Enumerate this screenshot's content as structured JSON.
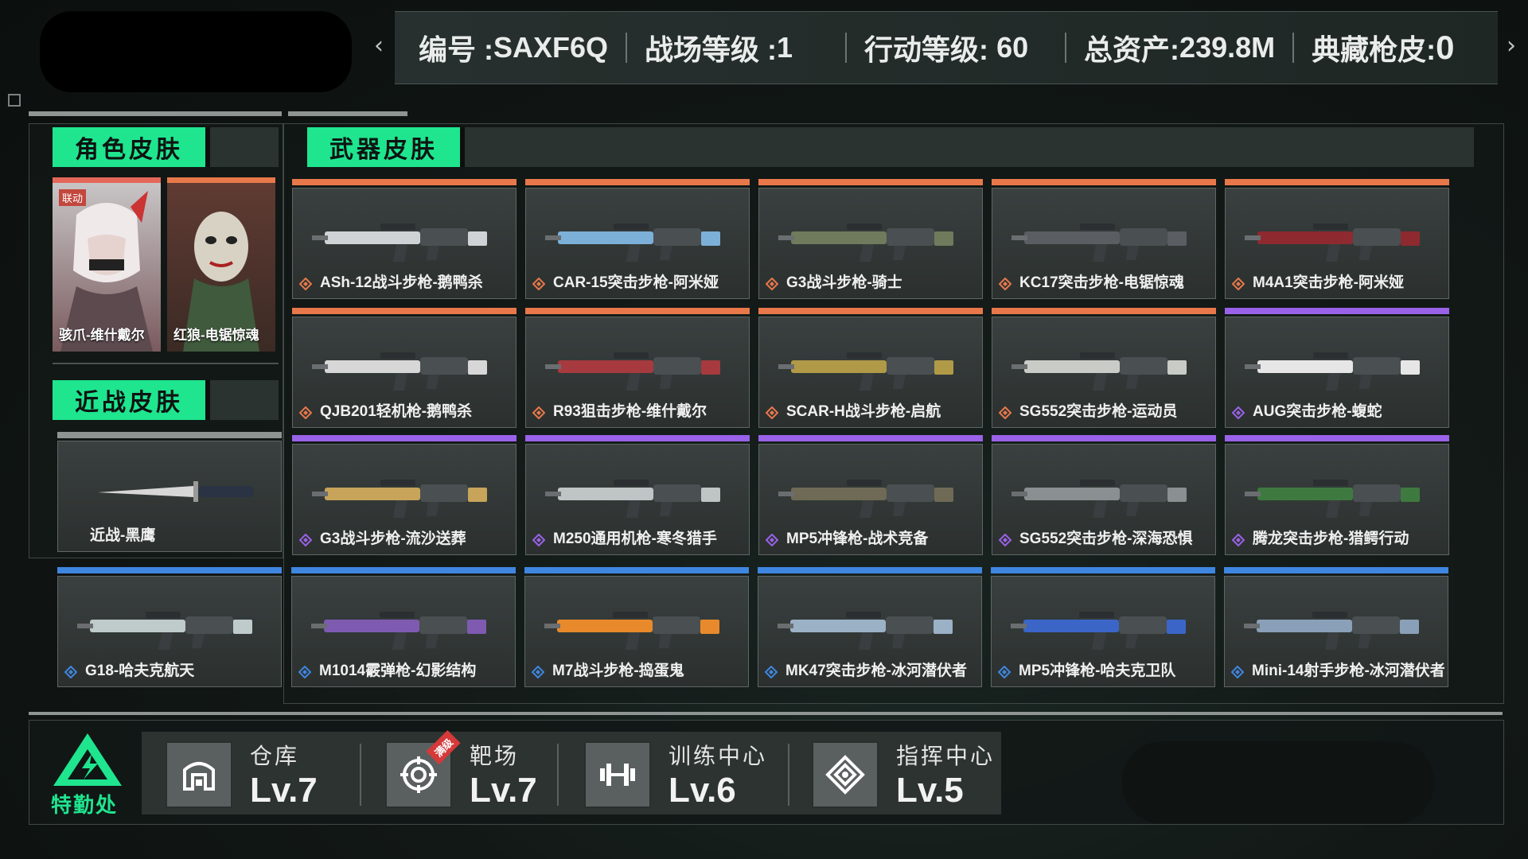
{
  "header": {
    "id_label": "编号 :",
    "id_value": "SAXF6Q",
    "battlefield_label": "战场等级 :",
    "battlefield_value": "1",
    "ops_label": "行动等级:",
    "ops_value": "60",
    "assets_label": "总资产:",
    "assets_value": "239.8M",
    "skins_label": "典藏枪皮:",
    "skins_value": "0"
  },
  "sections": {
    "character": "角色皮肤",
    "melee": "近战皮肤",
    "weapon": "武器皮肤"
  },
  "characters": [
    {
      "name": "骇爪-维什戴尔",
      "badge": "联动"
    },
    {
      "name": "红狼-电锯惊魂"
    }
  ],
  "melee": [
    {
      "name": "近战-黑鹰"
    }
  ],
  "colors": {
    "orange": "#e8784a",
    "purple": "#9a62e8",
    "blue": "#3f86e0",
    "accent": "#1fe58f"
  },
  "weapons": [
    {
      "name": "ASh-12战斗步枪-鹅鸭杀",
      "rarity": "orange"
    },
    {
      "name": "CAR-15突击步枪-阿米娅",
      "rarity": "orange"
    },
    {
      "name": "G3战斗步枪-骑士",
      "rarity": "orange"
    },
    {
      "name": "KC17突击步枪-电锯惊魂",
      "rarity": "orange"
    },
    {
      "name": "M4A1突击步枪-阿米娅",
      "rarity": "orange"
    },
    {
      "name": "QJB201轻机枪-鹅鸭杀",
      "rarity": "orange"
    },
    {
      "name": "R93狙击步枪-维什戴尔",
      "rarity": "orange"
    },
    {
      "name": "SCAR-H战斗步枪-启航",
      "rarity": "orange"
    },
    {
      "name": "SG552突击步枪-运动员",
      "rarity": "orange"
    },
    {
      "name": "AUG突击步枪-蝮蛇",
      "rarity": "purple"
    },
    {
      "name": "G3战斗步枪-流沙送葬",
      "rarity": "purple"
    },
    {
      "name": "M250通用机枪-寒冬猎手",
      "rarity": "purple"
    },
    {
      "name": "MP5冲锋枪-战术竞备",
      "rarity": "purple"
    },
    {
      "name": "SG552突击步枪-深海恐惧",
      "rarity": "purple"
    },
    {
      "name": "腾龙突击步枪-猎鳄行动",
      "rarity": "purple"
    },
    {
      "name": "G18-哈夫克航天",
      "rarity": "blue"
    },
    {
      "name": "M1014霰弹枪-幻影结构",
      "rarity": "blue"
    },
    {
      "name": "M7战斗步枪-捣蛋鬼",
      "rarity": "blue"
    },
    {
      "name": "MK47突击步枪-冰河潜伏者",
      "rarity": "blue"
    },
    {
      "name": "MP5冲锋枪-哈夫克卫队",
      "rarity": "blue"
    },
    {
      "name": "Mini-14射手步枪-冰河潜伏者",
      "rarity": "blue"
    }
  ],
  "footer": {
    "logo_text": "特勤处",
    "facilities": [
      {
        "name": "仓库",
        "level": "Lv.7",
        "icon": "warehouse-icon"
      },
      {
        "name": "靶场",
        "level": "Lv.7",
        "icon": "target-icon",
        "tag": "满级"
      },
      {
        "name": "训练中心",
        "level": "Lv.6",
        "icon": "dumbbell-icon"
      },
      {
        "name": "指挥中心",
        "level": "Lv.5",
        "icon": "command-icon"
      }
    ]
  }
}
